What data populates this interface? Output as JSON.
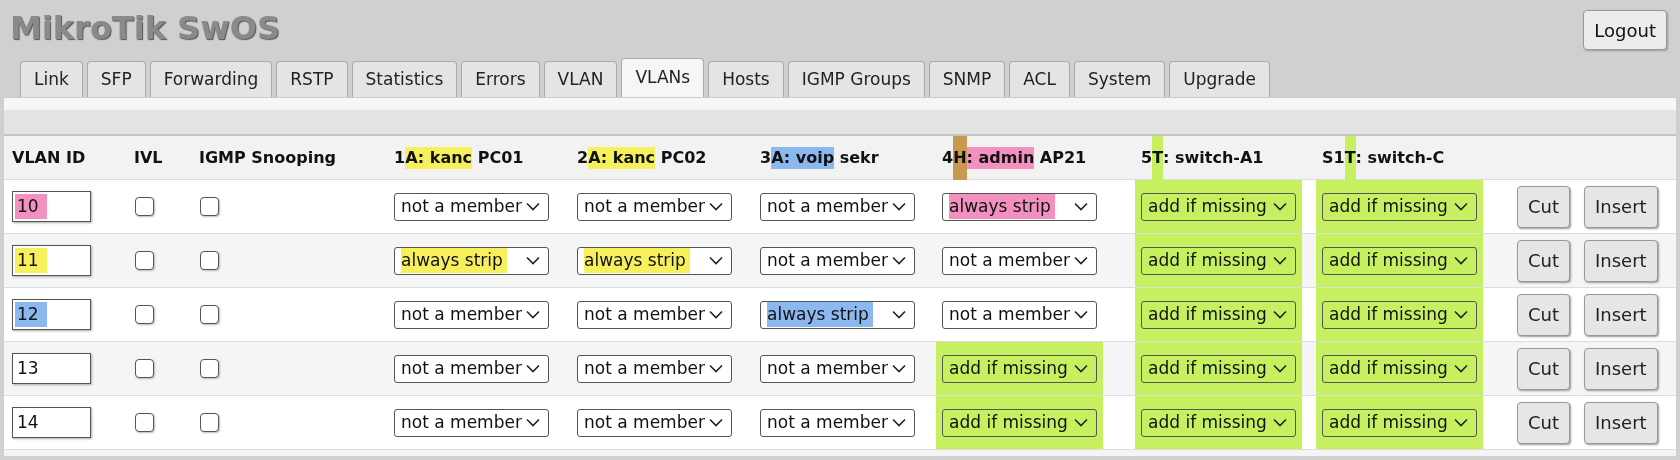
{
  "title": "MikroTik SwOS",
  "logout": "Logout",
  "tabs": [
    {
      "label": "Link",
      "selected": false
    },
    {
      "label": "SFP",
      "selected": false
    },
    {
      "label": "Forwarding",
      "selected": false
    },
    {
      "label": "RSTP",
      "selected": false
    },
    {
      "label": "Statistics",
      "selected": false
    },
    {
      "label": "Errors",
      "selected": false
    },
    {
      "label": "VLAN",
      "selected": false
    },
    {
      "label": "VLANs",
      "selected": true
    },
    {
      "label": "Hosts",
      "selected": false
    },
    {
      "label": "IGMP Groups",
      "selected": false
    },
    {
      "label": "SNMP",
      "selected": false
    },
    {
      "label": "ACL",
      "selected": false
    },
    {
      "label": "System",
      "selected": false
    },
    {
      "label": "Upgrade",
      "selected": false
    }
  ],
  "table": {
    "columns": [
      {
        "segments": [
          {
            "text": "VLAN ID"
          }
        ]
      },
      {
        "segments": [
          {
            "text": "IVL"
          }
        ]
      },
      {
        "segments": [
          {
            "text": "IGMP Snooping"
          }
        ]
      },
      {
        "segments": [
          {
            "text": "1"
          },
          {
            "text": "A: kanc",
            "color": "#f7f05c",
            "kind": "text"
          },
          {
            "text": " PC01"
          }
        ]
      },
      {
        "segments": [
          {
            "text": "2"
          },
          {
            "text": "A: kanc",
            "color": "#f7f05c",
            "kind": "text"
          },
          {
            "text": " PC02"
          }
        ]
      },
      {
        "segments": [
          {
            "text": "3"
          },
          {
            "text": "A: voip",
            "color": "#8cb8f0",
            "kind": "text"
          },
          {
            "text": " sekr"
          }
        ]
      },
      {
        "segments": [
          {
            "text": "4"
          },
          {
            "text": "H",
            "color": "#c89a50",
            "kind": "bar"
          },
          {
            "text": ": admin",
            "color": "#f291c0",
            "kind": "text"
          },
          {
            "text": " AP21"
          }
        ]
      },
      {
        "segments": [
          {
            "text": "5"
          },
          {
            "text": "T",
            "color": "#c6f060",
            "kind": "bar"
          },
          {
            "text": ": switch-A1"
          }
        ]
      },
      {
        "segments": [
          {
            "text": "S1"
          },
          {
            "text": "T",
            "color": "#c6f060",
            "kind": "bar"
          },
          {
            "text": ": switch-C"
          }
        ]
      }
    ],
    "rows": [
      {
        "vlan_id": {
          "value": "10",
          "color": "#f291c0"
        },
        "ivl": {
          "checked": false
        },
        "igmp_snooping": {
          "checked": false
        },
        "ports": [
          {
            "value": "not a member"
          },
          {
            "value": "not a member"
          },
          {
            "value": "not a member"
          },
          {
            "value": "always strip",
            "highlight": {
              "kind": "text",
              "color": "#f291c0"
            }
          },
          {
            "value": "add if missing",
            "highlight": {
              "kind": "block",
              "color": "#c6f060"
            }
          },
          {
            "value": "add if missing",
            "highlight": {
              "kind": "block",
              "color": "#c6f060"
            }
          }
        ],
        "buttons": [
          "Cut",
          "Insert"
        ]
      },
      {
        "vlan_id": {
          "value": "11",
          "color": "#f7f05c"
        },
        "ivl": {
          "checked": false
        },
        "igmp_snooping": {
          "checked": false
        },
        "ports": [
          {
            "value": "always strip",
            "highlight": {
              "kind": "text",
              "color": "#f7f05c"
            }
          },
          {
            "value": "always strip",
            "highlight": {
              "kind": "text",
              "color": "#f7f05c"
            }
          },
          {
            "value": "not a member"
          },
          {
            "value": "not a member"
          },
          {
            "value": "add if missing",
            "highlight": {
              "kind": "block",
              "color": "#c6f060"
            }
          },
          {
            "value": "add if missing",
            "highlight": {
              "kind": "block",
              "color": "#c6f060"
            }
          }
        ],
        "buttons": [
          "Cut",
          "Insert"
        ]
      },
      {
        "vlan_id": {
          "value": "12",
          "color": "#8cb8f0"
        },
        "ivl": {
          "checked": false
        },
        "igmp_snooping": {
          "checked": false
        },
        "ports": [
          {
            "value": "not a member"
          },
          {
            "value": "not a member"
          },
          {
            "value": "always strip",
            "highlight": {
              "kind": "text",
              "color": "#8cb8f0"
            }
          },
          {
            "value": "not a member"
          },
          {
            "value": "add if missing",
            "highlight": {
              "kind": "block",
              "color": "#c6f060"
            }
          },
          {
            "value": "add if missing",
            "highlight": {
              "kind": "block",
              "color": "#c6f060"
            }
          }
        ],
        "buttons": [
          "Cut",
          "Insert"
        ]
      },
      {
        "vlan_id": {
          "value": "13"
        },
        "ivl": {
          "checked": false
        },
        "igmp_snooping": {
          "checked": false
        },
        "ports": [
          {
            "value": "not a member"
          },
          {
            "value": "not a member"
          },
          {
            "value": "not a member"
          },
          {
            "value": "add if missing",
            "highlight": {
              "kind": "block",
              "color": "#c6f060"
            }
          },
          {
            "value": "add if missing",
            "highlight": {
              "kind": "block",
              "color": "#c6f060"
            }
          },
          {
            "value": "add if missing",
            "highlight": {
              "kind": "block",
              "color": "#c6f060"
            }
          }
        ],
        "buttons": [
          "Cut",
          "Insert"
        ]
      },
      {
        "vlan_id": {
          "value": "14"
        },
        "ivl": {
          "checked": false
        },
        "igmp_snooping": {
          "checked": false
        },
        "ports": [
          {
            "value": "not a member"
          },
          {
            "value": "not a member"
          },
          {
            "value": "not a member"
          },
          {
            "value": "add if missing",
            "highlight": {
              "kind": "block",
              "color": "#c6f060"
            }
          },
          {
            "value": "add if missing",
            "highlight": {
              "kind": "block",
              "color": "#c6f060"
            }
          },
          {
            "value": "add if missing",
            "highlight": {
              "kind": "block",
              "color": "#c6f060"
            }
          }
        ],
        "buttons": [
          "Cut",
          "Insert"
        ]
      }
    ]
  }
}
